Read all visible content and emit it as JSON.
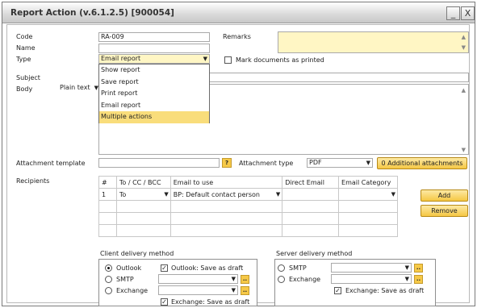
{
  "window": {
    "title": "Report Action (v.6.1.2.5) [900054]",
    "minimize_glyph": "_",
    "close_glyph": "X"
  },
  "form": {
    "code_label": "Code",
    "code_value": "RA-009",
    "name_label": "Name",
    "name_value": "",
    "type_label": "Type",
    "type_value": "Email report",
    "remarks_label": "Remarks",
    "mark_printed_label": "Mark documents as printed",
    "subject_label": "Subject",
    "body_label": "Body",
    "body_format": "Plain text"
  },
  "type_options": [
    "Show report",
    "Save report",
    "Print report",
    "Email report",
    "Multiple actions"
  ],
  "attachment": {
    "template_label": "Attachment template",
    "template_btn": "?",
    "type_label": "Attachment type",
    "type_value": "PDF",
    "additional_btn": "0 Additional attachments"
  },
  "recipients": {
    "label": "Recipients",
    "columns": [
      "#",
      "To / CC / BCC",
      "Email to use",
      "Direct Email",
      "Email Category"
    ],
    "rows": [
      {
        "num": "1",
        "to": "To",
        "email_to_use": "BP: Default contact person",
        "direct": "",
        "category": ""
      }
    ],
    "add_btn": "Add",
    "remove_btn": "Remove"
  },
  "client_delivery": {
    "title": "Client delivery method",
    "outlook": "Outlook",
    "outlook_draft": "Outlook: Save as draft",
    "smtp": "SMTP",
    "exchange": "Exchange",
    "exchange_draft": "Exchange: Save as draft",
    "selected": "Outlook",
    "dots": ".."
  },
  "server_delivery": {
    "title": "Server delivery method",
    "smtp": "SMTP",
    "exchange": "Exchange",
    "exchange_draft": "Exchange: Save as draft",
    "dots": ".."
  },
  "colors": {
    "accent_button": "#f5c743",
    "selected_item": "#f9dd7b",
    "remarks_bg": "#fff6c4"
  }
}
